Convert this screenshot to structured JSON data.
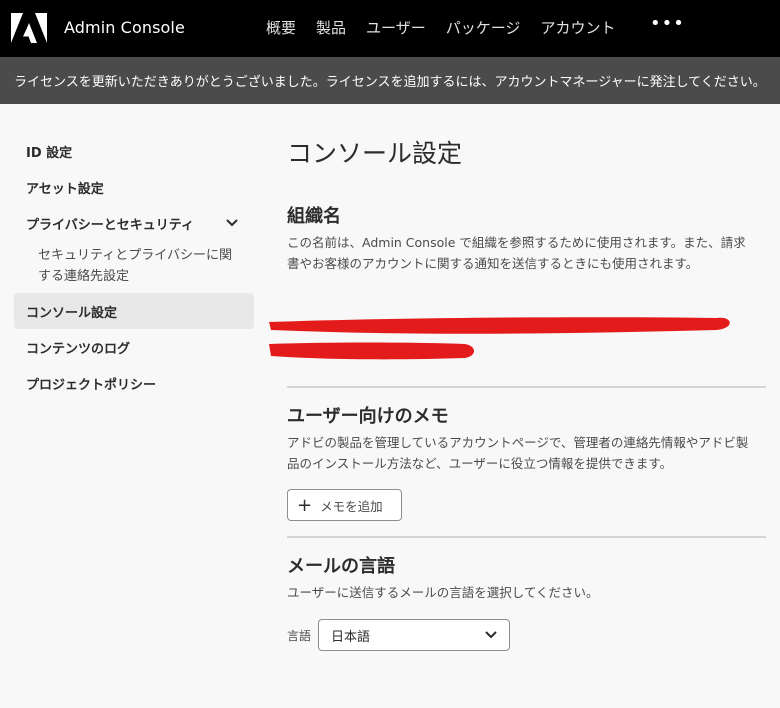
{
  "header": {
    "app_title": "Admin Console",
    "nav": [
      "概要",
      "製品",
      "ユーザー",
      "パッケージ",
      "アカウント"
    ],
    "more": "•••"
  },
  "banner": {
    "text": "ライセンスを更新いただきありがとうございました。ライセンスを追加するには、アカウントマネージャーに発注してください。"
  },
  "sidebar": {
    "items": [
      {
        "label": "ID 設定"
      },
      {
        "label": "アセット設定"
      },
      {
        "label": "プライバシーとセキュリティ"
      },
      {
        "label": "コンソール設定"
      },
      {
        "label": "コンテンツのログ"
      },
      {
        "label": "プロジェクトポリシー"
      }
    ],
    "sub_item": "セキュリティとプライバシーに関する連絡先設定",
    "active": "コンソール設定"
  },
  "main": {
    "page_title": "コンソール設定",
    "org": {
      "title": "組織名",
      "desc": "この名前は、Admin Console で組織を参照するために使用されます。また、請求書やお客様のアカウントに関する通知を送信するときにも使用されます。"
    },
    "memo": {
      "title": "ユーザー向けのメモ",
      "desc": "アドビの製品を管理しているアカウントページで、管理者の連絡先情報やアドビ製品のインストール方法など、ユーザーに役立つ情報を提供できます。",
      "add_button": "メモを追加"
    },
    "mail_lang": {
      "title": "メールの言語",
      "desc": "ユーザーに送信するメールの言語を選択してください。",
      "label": "言語",
      "selected": "日本語"
    }
  },
  "colors": {
    "topbar": "#000000",
    "banner": "#4b4b4b",
    "redaction": "#e31b1b"
  }
}
